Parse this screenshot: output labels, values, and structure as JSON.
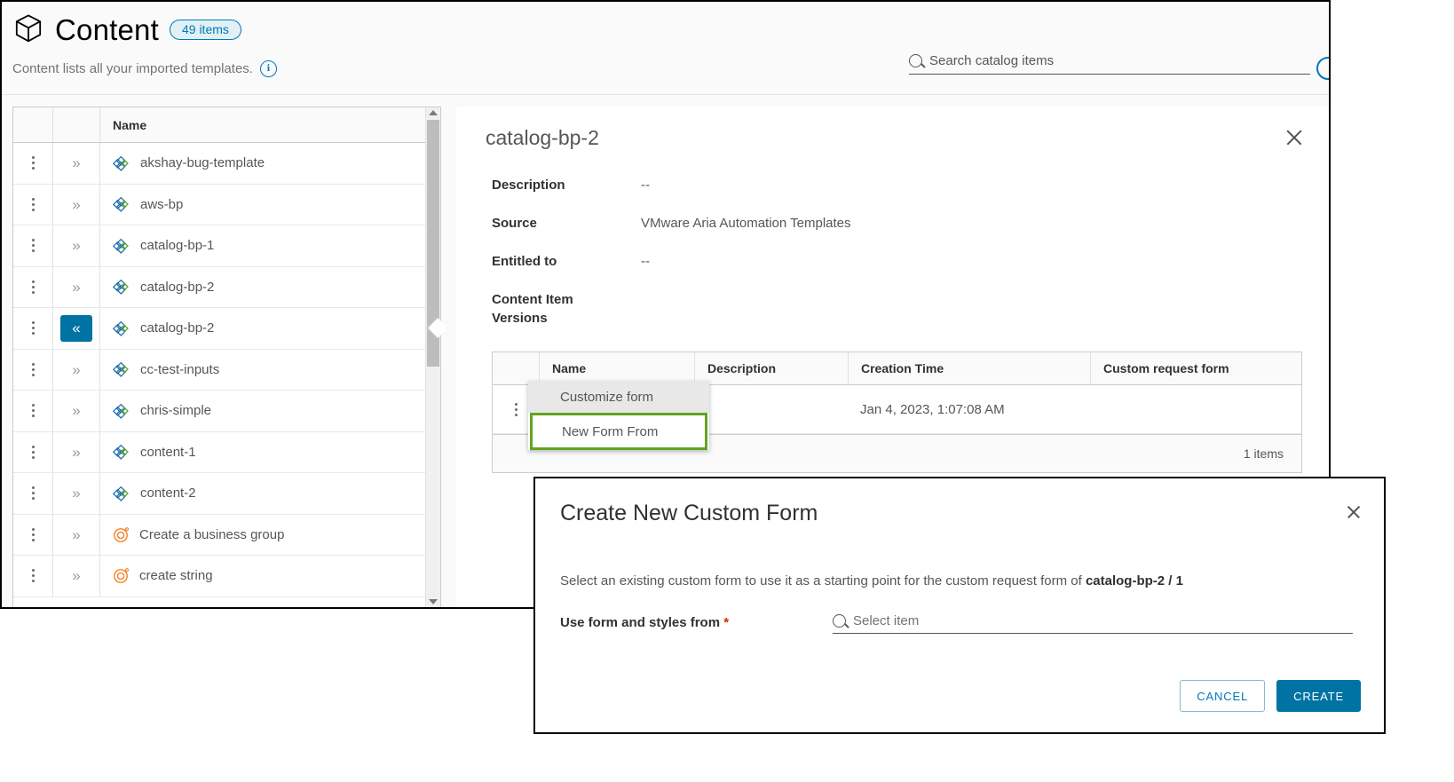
{
  "header": {
    "title": "Content",
    "item_count_badge": "49 items",
    "subtitle": "Content lists all your imported templates.",
    "info_icon": "info-icon",
    "package_icon": "package-icon"
  },
  "search": {
    "placeholder": "Search catalog items",
    "value": "",
    "icon": "search-icon"
  },
  "list": {
    "columns": [
      "",
      "",
      "Name"
    ],
    "rows": [
      {
        "name": "akshay-bug-template",
        "icon": "blueprint-icon",
        "expand": "chevron-double-right-icon",
        "selected": false
      },
      {
        "name": "aws-bp",
        "icon": "blueprint-icon",
        "expand": "chevron-double-right-icon",
        "selected": false
      },
      {
        "name": "catalog-bp-1",
        "icon": "blueprint-icon",
        "expand": "chevron-double-right-icon",
        "selected": false
      },
      {
        "name": "catalog-bp-2",
        "icon": "blueprint-icon",
        "expand": "chevron-double-right-icon",
        "selected": false
      },
      {
        "name": "catalog-bp-2",
        "icon": "blueprint-icon",
        "expand": "chevron-double-left-icon",
        "selected": true
      },
      {
        "name": "cc-test-inputs",
        "icon": "blueprint-icon",
        "expand": "chevron-double-right-icon",
        "selected": false
      },
      {
        "name": "chris-simple",
        "icon": "blueprint-icon",
        "expand": "chevron-double-right-icon",
        "selected": false
      },
      {
        "name": "content-1",
        "icon": "blueprint-icon",
        "expand": "chevron-double-right-icon",
        "selected": false
      },
      {
        "name": "content-2",
        "icon": "blueprint-icon",
        "expand": "chevron-double-right-icon",
        "selected": false
      },
      {
        "name": "Create a business group",
        "icon": "workflow-icon",
        "expand": "chevron-double-right-icon",
        "selected": false
      },
      {
        "name": "create string",
        "icon": "workflow-icon",
        "expand": "chevron-double-right-icon",
        "selected": false
      }
    ]
  },
  "detail": {
    "title": "catalog-bp-2",
    "close_icon": "close-icon",
    "fields": [
      {
        "label": "Description",
        "value": "--"
      },
      {
        "label": "Source",
        "value": "VMware Aria Automation Templates"
      },
      {
        "label": "Entitled to",
        "value": "--"
      },
      {
        "label": "Content Item Versions",
        "value": ""
      }
    ],
    "versions_table": {
      "columns": [
        "Name",
        "Description",
        "Creation Time",
        "Custom request form"
      ],
      "rows": [
        {
          "name": "",
          "description": "",
          "creation_time": "Jan 4, 2023, 1:07:08 AM",
          "custom_request_form": ""
        }
      ],
      "footer": "1 items"
    }
  },
  "context_menu": {
    "items": [
      {
        "label": "Customize form",
        "state": "hover"
      },
      {
        "label": "New Form From",
        "state": "highlighted"
      }
    ],
    "highlight_color": "#62a420"
  },
  "modal": {
    "title": "Create New Custom Form",
    "close_icon": "close-icon",
    "description_prefix": "Select an existing custom form to use it as a starting point for the custom request form of ",
    "description_target": "catalog-bp-2 / 1",
    "field_label": "Use form and styles from",
    "required_marker": "*",
    "select_placeholder": "Select item",
    "select_value": "",
    "cancel_label": "CANCEL",
    "create_label": "CREATE"
  },
  "colors": {
    "accent": "#0072a3",
    "link": "#0079b8",
    "highlight_green": "#62a420",
    "required_red": "#e02200",
    "workflow_orange": "#f58220"
  }
}
